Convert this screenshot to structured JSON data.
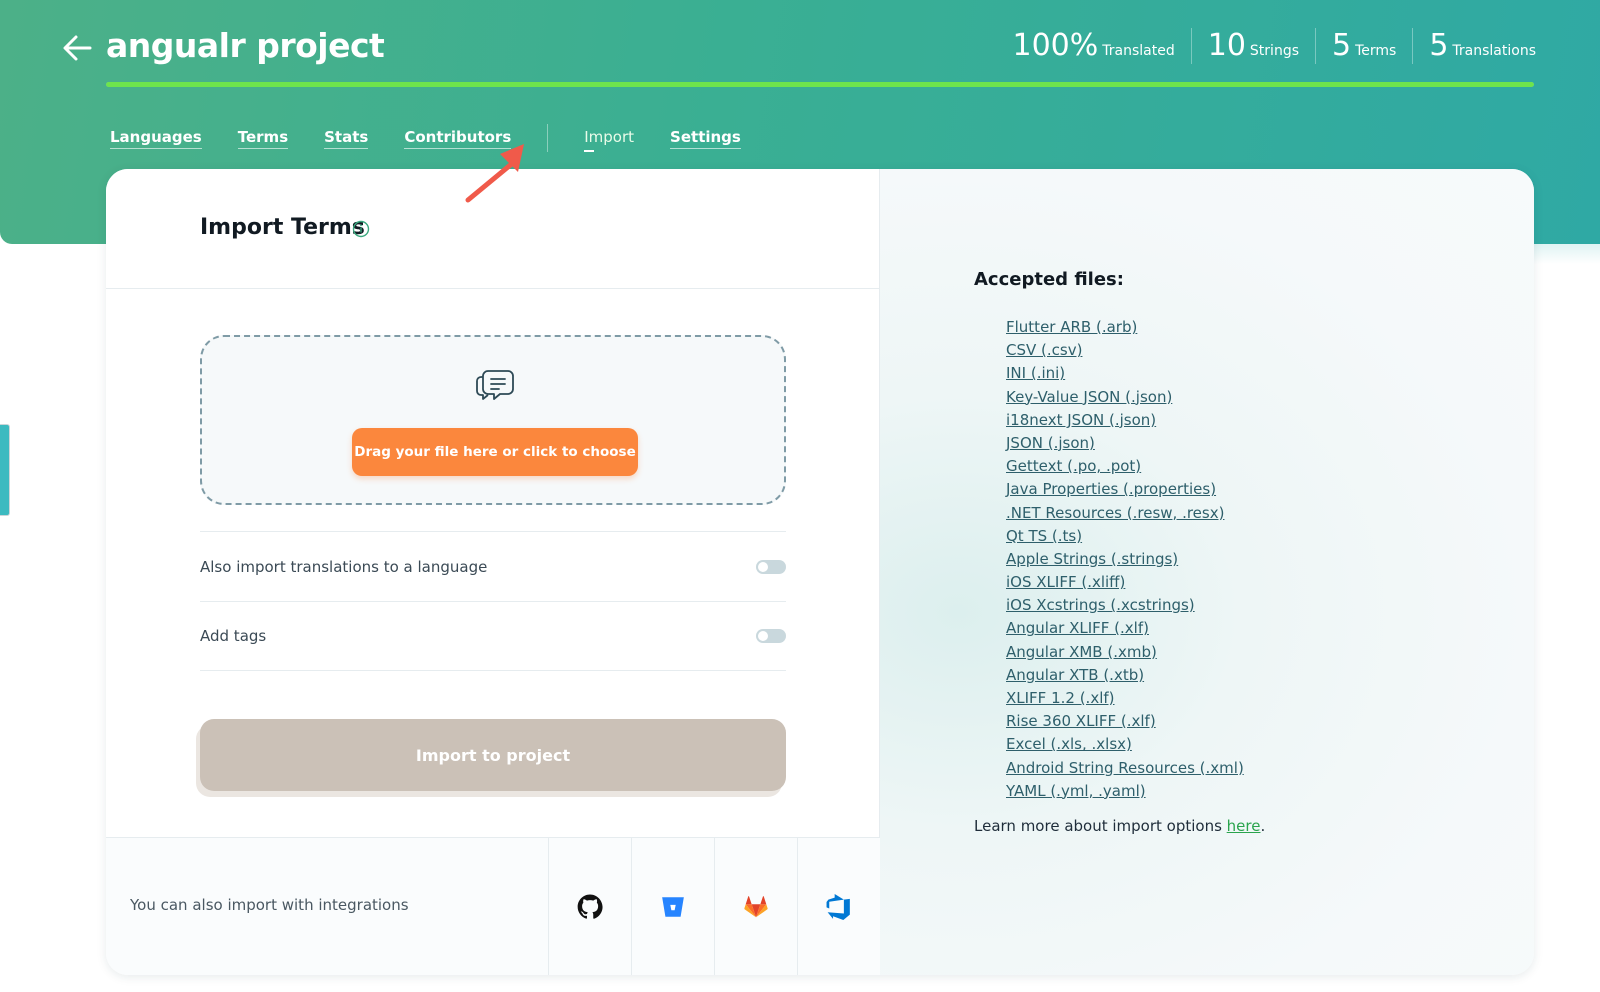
{
  "header": {
    "title": "angualr project",
    "stats": [
      {
        "value": "100%",
        "label": "Translated"
      },
      {
        "value": "10",
        "label": "Strings"
      },
      {
        "value": "5",
        "label": "Terms"
      },
      {
        "value": "5",
        "label": "Translations"
      }
    ],
    "progress_percent": 100,
    "nav": [
      "Languages",
      "Terms",
      "Stats",
      "Contributors",
      "Import",
      "Settings"
    ],
    "active_nav": "Import"
  },
  "import_panel": {
    "title": "Import Terms",
    "dropzone_button": "Drag your file here or click to choose",
    "options": [
      {
        "label": "Also import translations to a language",
        "enabled": false
      },
      {
        "label": "Add tags",
        "enabled": false
      }
    ],
    "submit_label": "Import to project",
    "integrations_text": "You can also import with integrations",
    "integrations": [
      "github-icon",
      "bitbucket-icon",
      "gitlab-icon",
      "azure-devops-icon"
    ]
  },
  "accepted": {
    "title": "Accepted files:",
    "files": [
      "Flutter ARB (.arb)",
      "CSV (.csv)",
      "INI (.ini)",
      "Key-Value JSON (.json)",
      "i18next JSON (.json)",
      "JSON (.json)",
      "Gettext (.po, .pot)",
      "Java Properties (.properties)",
      ".NET Resources (.resw, .resx)",
      "Qt TS (.ts)",
      "Apple Strings (.strings)",
      "iOS XLIFF (.xliff)",
      "iOS Xcstrings (.xcstrings)",
      "Angular XLIFF (.xlf)",
      "Angular XMB (.xmb)",
      "Angular XTB (.xtb)",
      "XLIFF 1.2 (.xlf)",
      "Rise 360 XLIFF (.xlf)",
      "Excel (.xls, .xlsx)",
      "Android String Resources (.xml)",
      "YAML (.yml, .yaml)"
    ],
    "learn_more_prefix": "Learn more about import options ",
    "learn_more_link": "here",
    "learn_more_suffix": "."
  },
  "colors": {
    "hero_start": "#4cb088",
    "hero_end": "#2fa9a4",
    "progress": "#6ee44c",
    "dropzone_button": "#fb873d",
    "submit_disabled": "#cbc1b7",
    "pointer_arrow": "#f05a4a"
  }
}
